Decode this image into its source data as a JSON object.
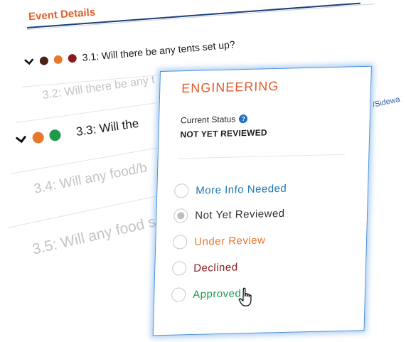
{
  "event_details": {
    "header": "Event Details",
    "questions": [
      {
        "label": "3.1: Will there be any tents set up?",
        "expanded": true,
        "status_dots": [
          "#4a2414",
          "#e8782d",
          "#8b1c1c"
        ]
      },
      {
        "label": "3.2: Will there be any t",
        "expanded": false,
        "status_dots": []
      },
      {
        "label": "3.3: Will the",
        "expanded": true,
        "status_dots": [
          "#e8782d",
          "#1e9a4a"
        ]
      },
      {
        "label": "3.4: Will any food/b",
        "expanded": false,
        "status_dots": []
      },
      {
        "label": "3.5: Will any food s",
        "expanded": false,
        "status_dots": []
      }
    ],
    "side_clip_text": "/Sidewa"
  },
  "popup": {
    "title": "ENGINEERING",
    "current_status_label": "Current Status",
    "help_icon": "question-circle-icon",
    "current_status_value": "NOT YET REVIEWED",
    "options": [
      {
        "label": "More Info Needed",
        "color": "#1f78b4",
        "selected": false
      },
      {
        "label": "Not Yet Reviewed",
        "color": "#333333",
        "selected": true
      },
      {
        "label": "Under Review",
        "color": "#e8782d",
        "selected": false
      },
      {
        "label": "Declined",
        "color": "#8b1c1c",
        "selected": false
      },
      {
        "label": "Approved",
        "color": "#1e9a4a",
        "selected": false
      }
    ],
    "cursor_icon": "hand-pointer-icon"
  },
  "colors": {
    "accent_orange": "#e15a2a",
    "header_rule": "#1d3f73",
    "popup_border": "#4a90d9"
  }
}
